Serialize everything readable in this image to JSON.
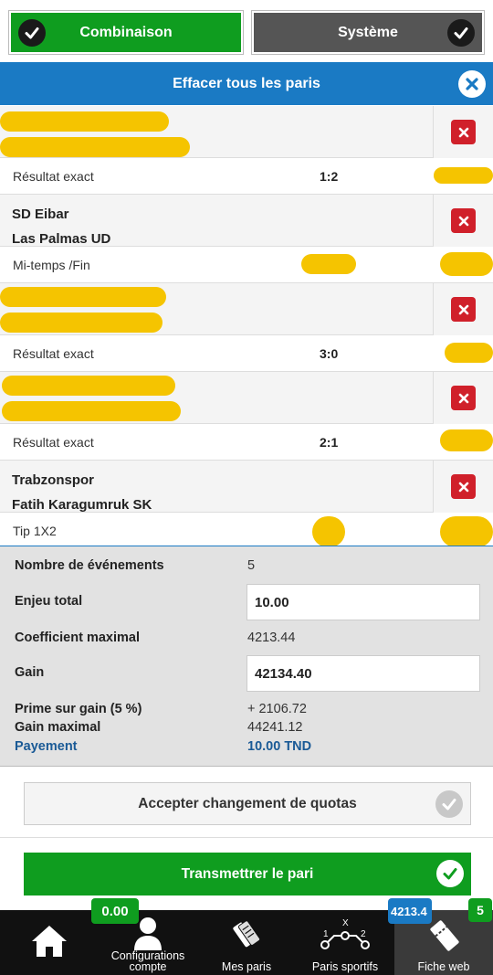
{
  "tabs": {
    "combination": "Combinaison",
    "system": "Système"
  },
  "clear_all": "Effacer tous les paris",
  "bets": [
    {
      "home": "",
      "away": "",
      "market": "Résultat exact",
      "pick": "1:2",
      "redacted": true
    },
    {
      "home": "SD Eibar",
      "away": "Las Palmas UD",
      "market": "Mi-temps /Fin",
      "pick": "",
      "redacted": false
    },
    {
      "home": "",
      "away": "",
      "market": "Résultat exact",
      "pick": "3:0",
      "redacted": true
    },
    {
      "home": "",
      "away": "",
      "market": "Résultat exact",
      "pick": "2:1",
      "redacted": true
    },
    {
      "home": "Trabzonspor",
      "away": "Fatih Karagumruk SK",
      "market": "Tip 1X2",
      "pick": "",
      "redacted": false
    }
  ],
  "summary": {
    "events_label": "Nombre de événements",
    "events_value": "5",
    "stake_label": "Enjeu total",
    "stake_value": "10.00",
    "max_coef_label": "Coefficient maximal",
    "max_coef_value": "4213.44",
    "gain_label": "Gain",
    "gain_value": "42134.40",
    "bonus_label": "Prime sur gain (5 %)",
    "bonus_value": "+ 2106.72",
    "max_gain_label": "Gain maximal",
    "max_gain_value": "44241.12",
    "payment_label": "Payement",
    "payment_value": "10.00 TND"
  },
  "accept_odds_change": "Accepter changement de quotas",
  "submit": "Transmettrer le pari",
  "nav": {
    "home": "",
    "account_config": "Configurations compte",
    "my_bets": "Mes paris",
    "sports_bets": "Paris sportifs",
    "web_slip": "Fiche web",
    "balance_badge": "0.00",
    "odds_badge": "4213.4",
    "count_badge": "5"
  },
  "colors": {
    "green": "#0f9d1f",
    "blue": "#1a7ac4",
    "red": "#d0202a",
    "dark": "#111111",
    "redaction": "#f5c400"
  }
}
